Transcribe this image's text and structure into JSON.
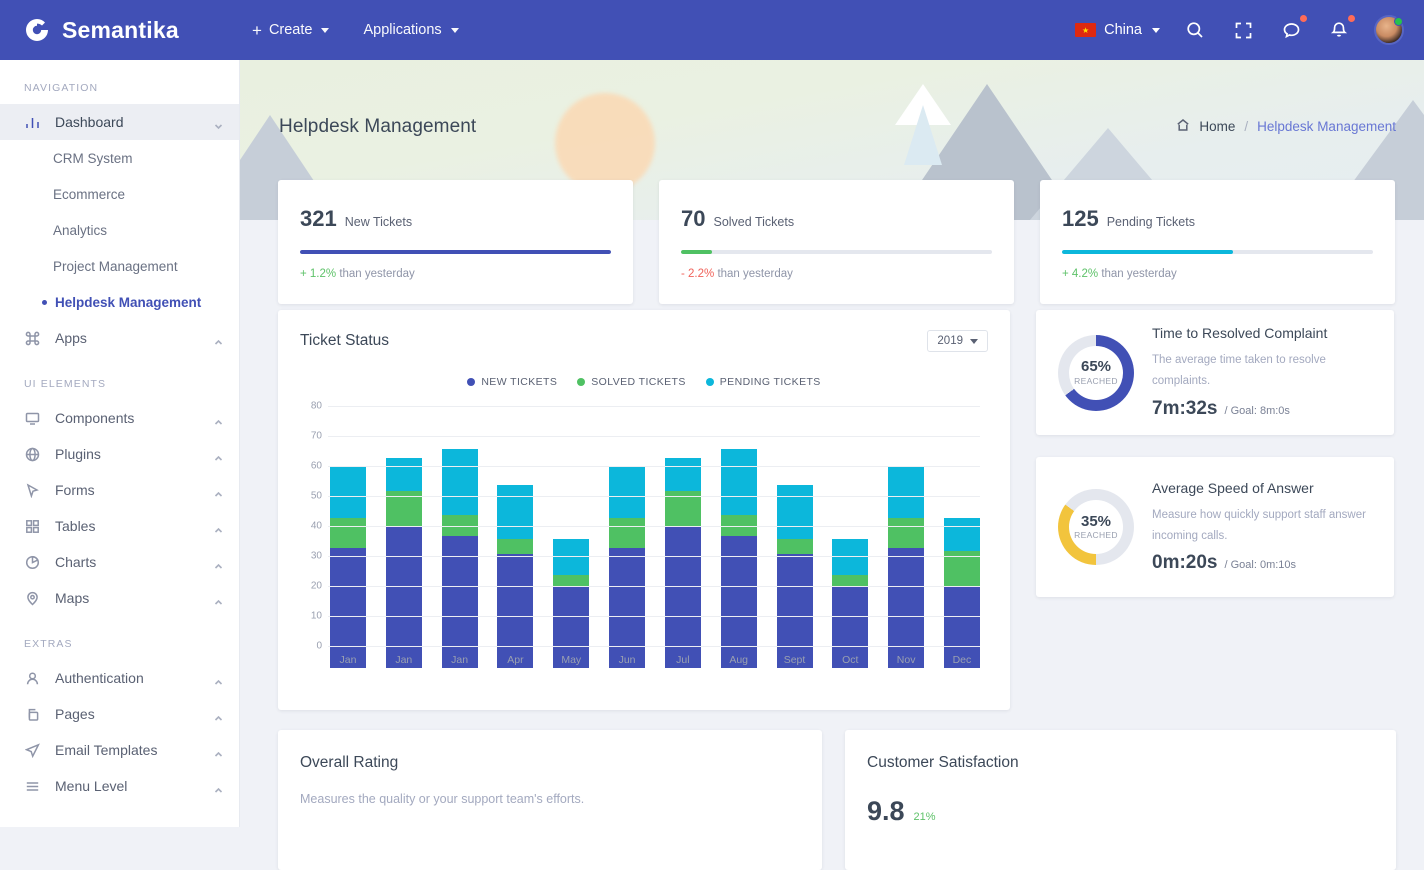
{
  "topbar": {
    "brand": "Semantika",
    "brand_icon": "semantika-logo-icon",
    "nav": [
      {
        "label": "Create",
        "icon": "plus-icon",
        "has_caret": true
      },
      {
        "label": "Applications",
        "icon": "",
        "has_caret": true
      }
    ],
    "language": {
      "label": "China",
      "flag": "china-flag-icon",
      "star": "★"
    },
    "icons": [
      "search-icon",
      "fullscreen-icon",
      "messages-icon",
      "notifications-icon"
    ],
    "avatar": "user-avatar"
  },
  "sidebar": {
    "captions": {
      "navigation": "NAVIGATION",
      "ui_elements": "UI ELEMENTS",
      "extras": "EXTRAS"
    },
    "dashboard": {
      "label": "Dashboard",
      "icon": "bar-chart-icon"
    },
    "dashboard_children": [
      {
        "label": "CRM System"
      },
      {
        "label": "Ecommerce"
      },
      {
        "label": "Analytics"
      },
      {
        "label": "Project Management"
      },
      {
        "label": "Helpdesk Management",
        "current": true
      }
    ],
    "apps": {
      "label": "Apps",
      "icon": "apps-grid-icon"
    },
    "ui_items": [
      {
        "label": "Components",
        "icon": "monitor-icon"
      },
      {
        "label": "Plugins",
        "icon": "globe-icon"
      },
      {
        "label": "Forms",
        "icon": "cursor-icon"
      },
      {
        "label": "Tables",
        "icon": "table-grid-icon"
      },
      {
        "label": "Charts",
        "icon": "pie-chart-icon"
      },
      {
        "label": "Maps",
        "icon": "map-pin-icon"
      }
    ],
    "extra_items": [
      {
        "label": "Authentication",
        "icon": "user-icon"
      },
      {
        "label": "Pages",
        "icon": "copy-icon"
      },
      {
        "label": "Email Templates",
        "icon": "send-icon"
      },
      {
        "label": "Menu Level",
        "icon": "menu-lines-icon"
      }
    ]
  },
  "hero": {
    "title": "Helpdesk Management",
    "breadcrumb": {
      "home": "Home",
      "separator": "/",
      "current": "Helpdesk Management",
      "home_icon": "home-icon"
    }
  },
  "stats": [
    {
      "number": "321",
      "label": "New Tickets",
      "delta": "+ 1.2%",
      "delta_rest": " than yesterday",
      "delta_color": "#5ec269",
      "bar_color": "#4150b5",
      "bar_pct": 100
    },
    {
      "number": "70",
      "label": "Solved Tickets",
      "delta": "- 2.2%",
      "delta_rest": " than yesterday",
      "delta_color": "#f0635b",
      "bar_color": "#4fc163",
      "bar_pct": 10
    },
    {
      "number": "125",
      "label": "Pending Tickets",
      "delta": "+ 4.2%",
      "delta_rest": " than yesterday",
      "delta_color": "#5ec269",
      "bar_color": "#0cb7db",
      "bar_pct": 55
    }
  ],
  "ticket_panel": {
    "title": "Ticket Status",
    "year": "2019"
  },
  "chart_data": {
    "type": "bar",
    "title": "Ticket Status",
    "stacked": true,
    "xlabel": "",
    "ylabel": "",
    "ylim": [
      0,
      80
    ],
    "yticks": [
      0,
      10,
      20,
      30,
      40,
      50,
      60,
      70,
      80
    ],
    "grid": true,
    "legend_position": "top-center",
    "categories": [
      "Jan",
      "Jan",
      "Jan",
      "Apr",
      "May",
      "Jun",
      "Jul",
      "Aug",
      "Sept",
      "Oct",
      "Nov",
      "Dec"
    ],
    "series": [
      {
        "name": "NEW TICKETS",
        "color": "#4150b5",
        "values": [
          40,
          47,
          44,
          38,
          27,
          40,
          47,
          44,
          38,
          27,
          40,
          27
        ]
      },
      {
        "name": "SOLVED TICKETS",
        "color": "#4fc163",
        "values": [
          10,
          12,
          7,
          5,
          4,
          10,
          12,
          7,
          5,
          4,
          10,
          12
        ]
      },
      {
        "name": "PENDING TICKETS",
        "color": "#0cb7db",
        "values": [
          17,
          11,
          22,
          18,
          12,
          17,
          11,
          22,
          18,
          12,
          17,
          11
        ]
      }
    ],
    "totals": [
      67,
      70,
      73,
      61,
      43,
      67,
      70,
      73,
      61,
      43,
      67,
      50
    ]
  },
  "kpis": [
    {
      "percent": "65%",
      "reached": "REACHED",
      "pct_value": 65,
      "ring_color": "#4150b5",
      "title": "Time to Resolved Complaint",
      "desc": "The average time taken to resolve complaints.",
      "value": "7m:32s",
      "goal": "/ Goal: 8m:0s"
    },
    {
      "percent": "35%",
      "reached": "REACHED",
      "pct_value": 35,
      "ring_color": "#f2c43d",
      "title": "Average Speed of Answer",
      "desc": "Measure how quickly support staff answer incoming calls.",
      "value": "0m:20s",
      "goal": "/ Goal: 0m:10s"
    }
  ],
  "bottom": {
    "rating": {
      "title": "Overall Rating",
      "desc": "Measures the quality or your support team's efforts."
    },
    "satisfaction": {
      "title": "Customer Satisfaction",
      "value": "9.8",
      "percent": "21%"
    }
  }
}
